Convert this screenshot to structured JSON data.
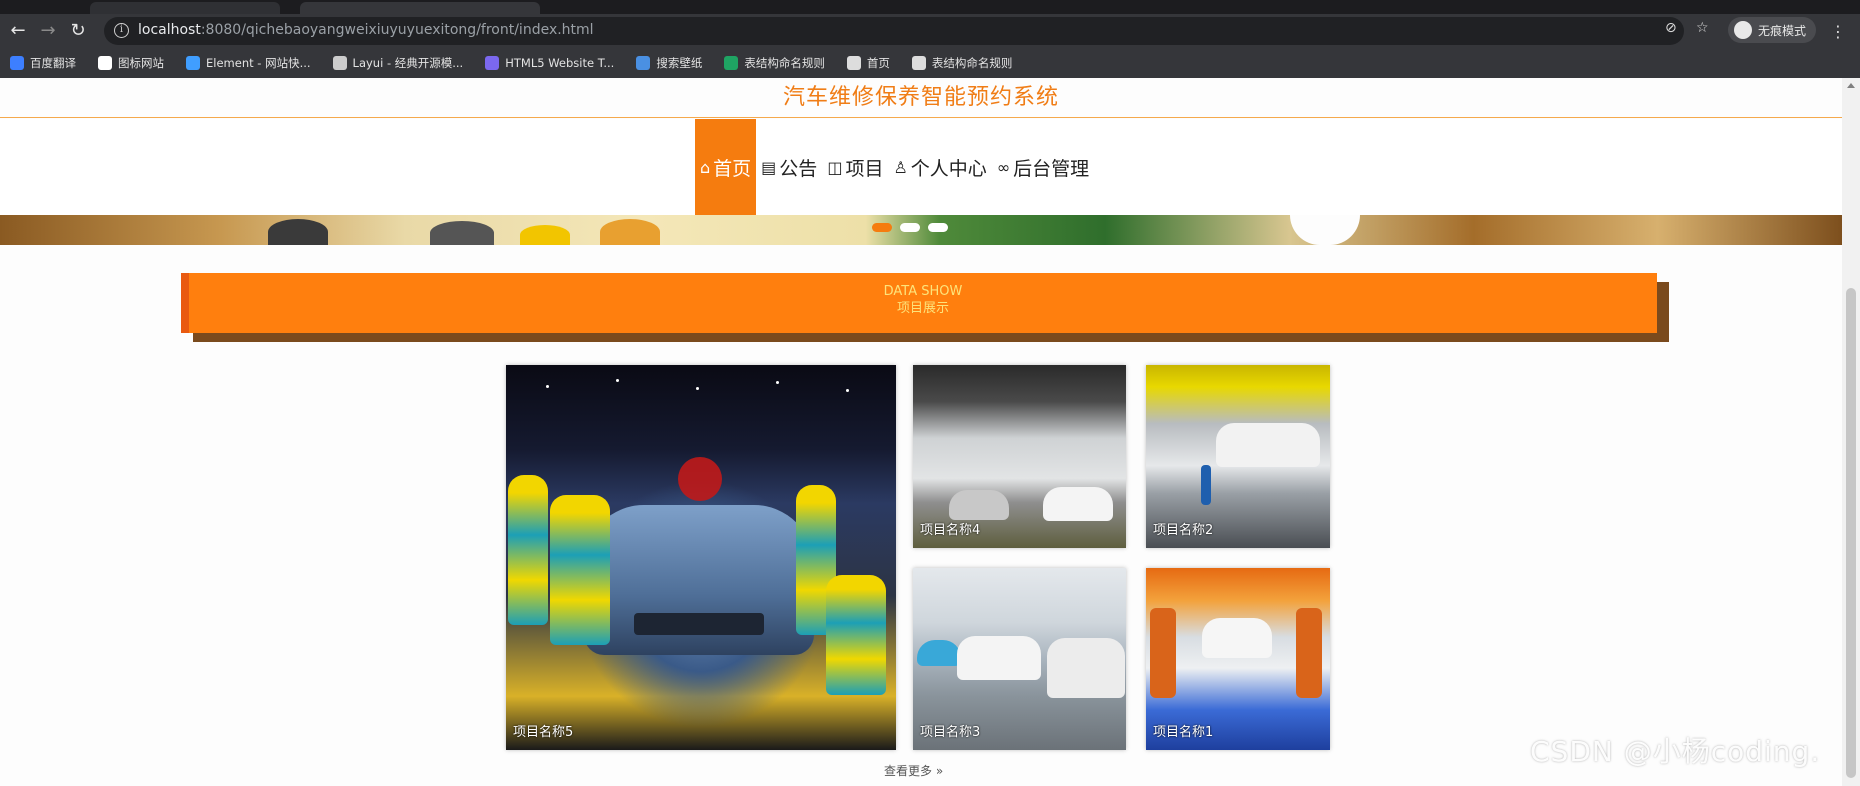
{
  "browser": {
    "url_host": "localhost",
    "url_rest": ":8080/qichebaoyangweixiuyuyuexitong/front/index.html",
    "incognito_label": "无痕模式",
    "bookmarks": [
      {
        "label": "百度翻译",
        "icon": "baidu-translate-icon",
        "color": "#3d7fff"
      },
      {
        "label": "图标网站",
        "icon": "flag-icon",
        "color": "#ffffff"
      },
      {
        "label": "Element - 网站快...",
        "icon": "element-icon",
        "color": "#409eff"
      },
      {
        "label": "Layui - 经典开源模...",
        "icon": "layui-icon",
        "color": "#cccccc"
      },
      {
        "label": "HTML5 Website T...",
        "icon": "html5-icon",
        "color": "#7b68ee"
      },
      {
        "label": "搜索壁纸",
        "icon": "wallpaper-icon",
        "color": "#4a90e2"
      },
      {
        "label": "表结构命名规则",
        "icon": "sheet-icon",
        "color": "#1fa463"
      },
      {
        "label": "首页",
        "icon": "globe-icon",
        "color": "#dddddd"
      },
      {
        "label": "表结构命名规则",
        "icon": "globe-icon",
        "color": "#dddddd"
      }
    ]
  },
  "site": {
    "title": "汽车维修保养智能预约系统",
    "accent": "#f57c0f",
    "nav": [
      {
        "label": "首页",
        "icon": "home-icon",
        "glyph": "⌂",
        "active": true
      },
      {
        "label": "公告",
        "icon": "notice-icon",
        "glyph": "▤",
        "active": false
      },
      {
        "label": "项目",
        "icon": "book-icon",
        "glyph": "◫",
        "active": false
      },
      {
        "label": "个人中心",
        "icon": "user-icon",
        "glyph": "♙",
        "active": false
      },
      {
        "label": "后台管理",
        "icon": "link-icon",
        "glyph": "∞",
        "active": false
      }
    ]
  },
  "section": {
    "title_en": "DATA SHOW",
    "title_cn": "项目展示"
  },
  "gallery": [
    {
      "id": "5",
      "name": "项目名称5"
    },
    {
      "id": "4",
      "name": "项目名称4"
    },
    {
      "id": "2",
      "name": "项目名称2"
    },
    {
      "id": "3",
      "name": "项目名称3"
    },
    {
      "id": "1",
      "name": "项目名称1"
    }
  ],
  "more_label": "查看更多 »",
  "watermark": "CSDN @小杨coding."
}
